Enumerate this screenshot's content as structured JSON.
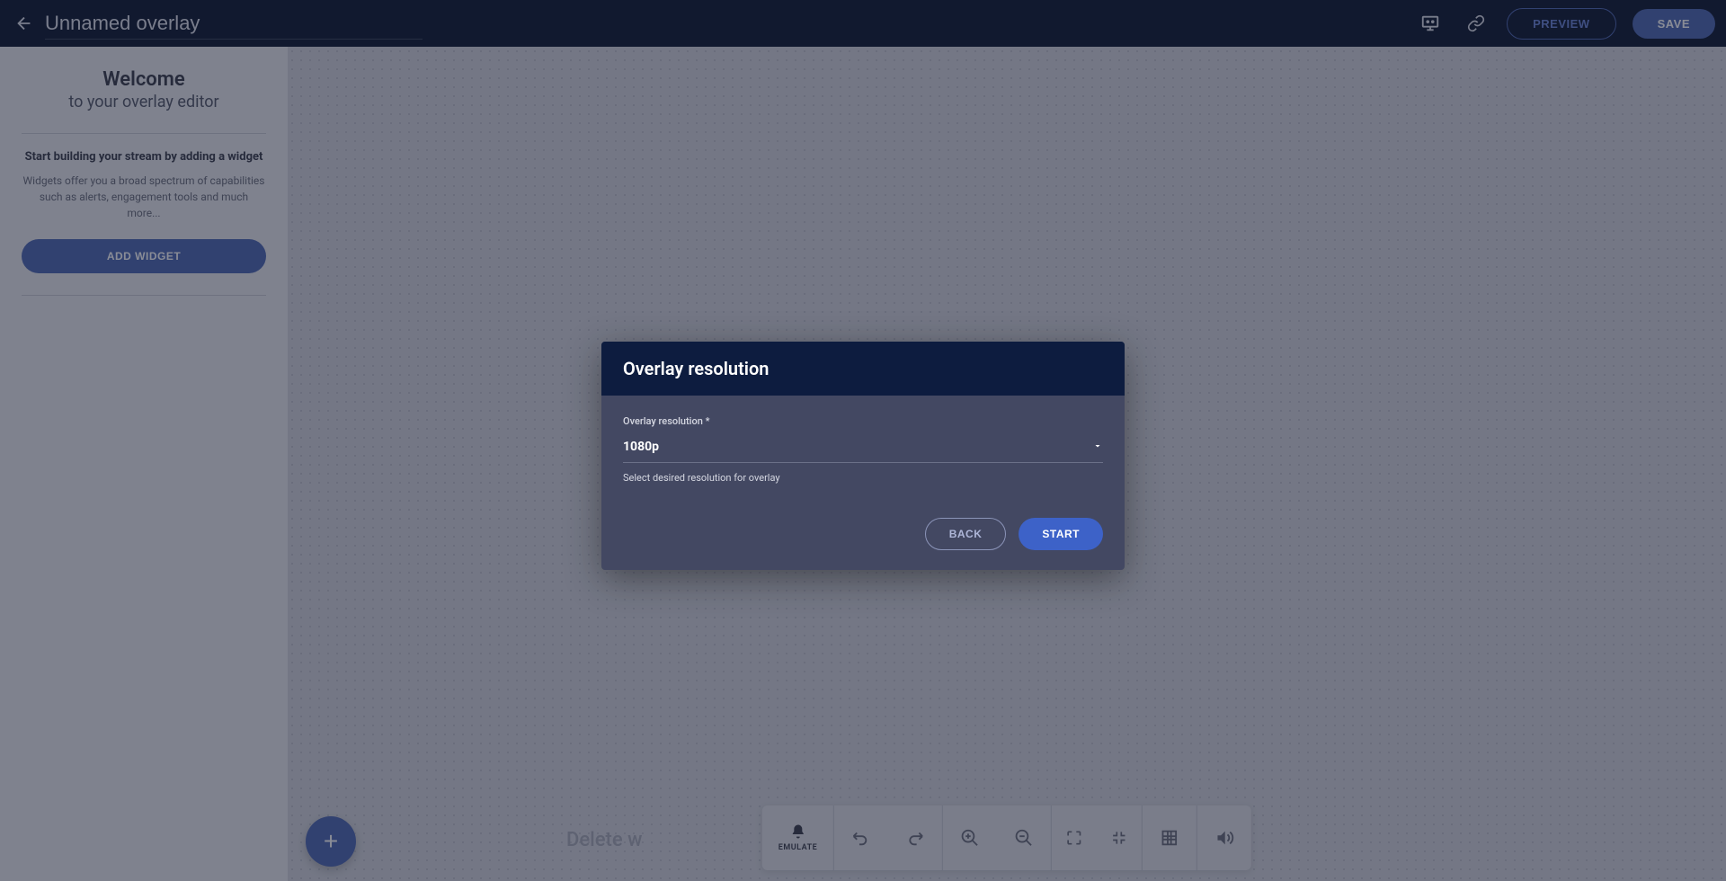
{
  "header": {
    "title": "Unnamed overlay",
    "preview_label": "PREVIEW",
    "save_label": "SAVE"
  },
  "sidebar": {
    "welcome_title": "Welcome",
    "welcome_subtitle": "to your overlay editor",
    "start_heading": "Start building your stream by adding a widget",
    "description": "Widgets offer you a broad spectrum of capabilities such as alerts, engagement tools and much more...",
    "add_widget_label": "ADD WIDGET"
  },
  "canvas": {
    "ghost_text": "Delete w"
  },
  "toolbar": {
    "emulate_label": "EMULATE"
  },
  "modal": {
    "title": "Overlay resolution",
    "field_label": "Overlay resolution *",
    "field_value": "1080p",
    "field_help": "Select desired resolution for overlay",
    "back_label": "BACK",
    "start_label": "START"
  }
}
